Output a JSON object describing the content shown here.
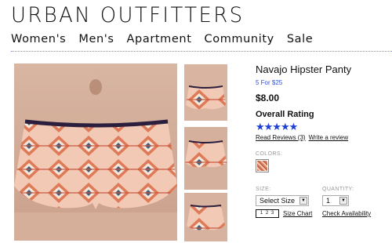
{
  "brand": {
    "logo_text": "URBAN OUTFITTERS"
  },
  "nav": {
    "items": [
      "Women's",
      "Men's",
      "Apartment",
      "Community",
      "Sale"
    ]
  },
  "product": {
    "title": "Navajo Hipster Panty",
    "promo": "5 For $25",
    "price": "$8.00",
    "rating_heading": "Overall Rating",
    "stars": "★★★★★",
    "rating_value": 5,
    "read_reviews": "Read Reviews (3)",
    "write_review": "Write a review",
    "colors_label": "COLORS:",
    "size_label": "SIZE:",
    "size_value": "Select Size",
    "quantity_label": "QUANTITY:",
    "quantity_value": "1",
    "ruler_text": "1 2 3",
    "size_chart": "Size Chart",
    "check_availability": "Check Availability"
  },
  "colors": {
    "nav_rule": "#8a8ad8",
    "promo": "#2d4fd3",
    "stars": "#1d3fd6",
    "waistband": "#2b1f3d",
    "fabric": "#e9a07e"
  }
}
